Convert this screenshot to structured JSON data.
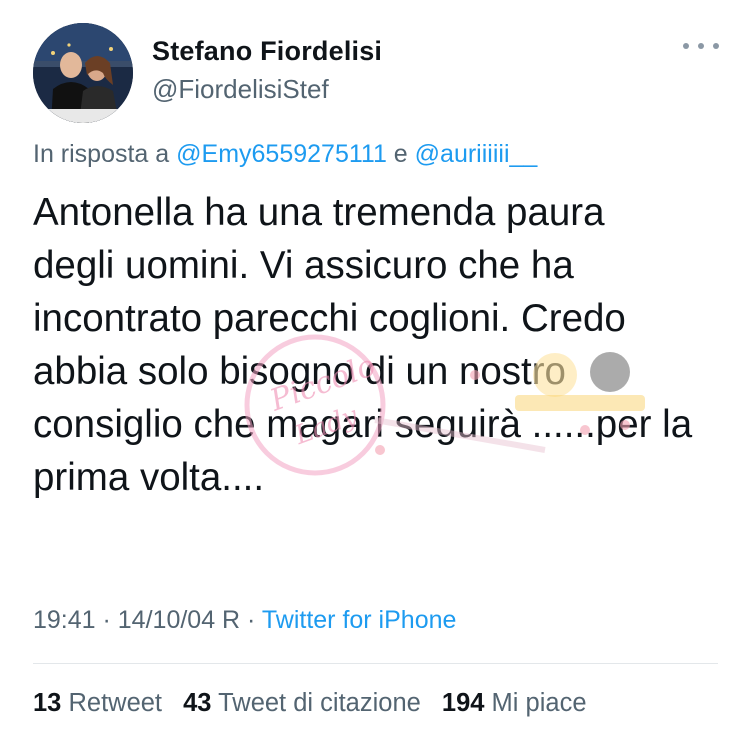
{
  "tweet": {
    "author_name": "Stefano Fiordelisi",
    "author_handle": "@FiordelisiStef",
    "more_icon": "more-horizontal-icon",
    "reply_prefix": "In risposta a ",
    "reply_user_1": "@Emy6559275111",
    "reply_join": " e ",
    "reply_user_2": "@auriiiiii__",
    "text_lines": [
      "Antonella ha una tremenda paura",
      "degli uomini. Vi assicuro che ha",
      "incontrato parecchi coglioni. Credo",
      "abbia solo bisogno di un nostro",
      "consiglio che magari seguirà ......per la",
      "prima volta...."
    ],
    "time": "19:41",
    "date": "14/10/04 R",
    "source": "Twitter for iPhone",
    "sep": " · "
  },
  "stats": {
    "retweets_count": "13",
    "retweets_label": "Retweet",
    "quotes_count": "43",
    "quotes_label": "Tweet di citazione",
    "likes_count": "194",
    "likes_label": "Mi piace"
  },
  "watermark": {
    "text_1": "Piccolo",
    "text_2": "Lady"
  },
  "colors": {
    "link": "#1d9bf0",
    "secondary": "#536471",
    "primary": "#0f1419"
  }
}
